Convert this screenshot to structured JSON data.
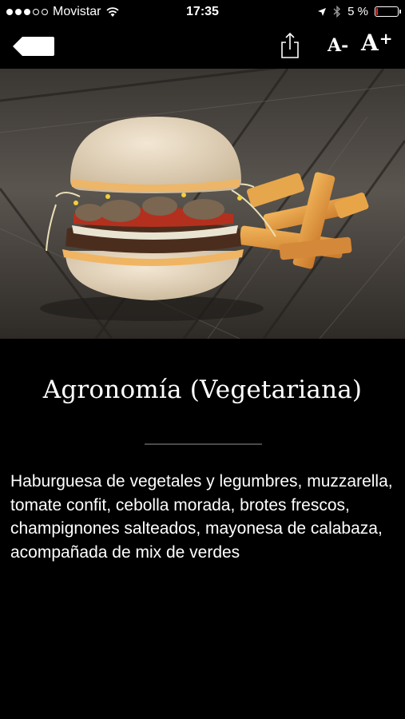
{
  "status_bar": {
    "carrier": "Movistar",
    "time": "17:35",
    "battery": "5 %",
    "battery_level": 0.05,
    "battery_color": "#e33333"
  },
  "nav": {
    "back_icon": "back-arrow-icon",
    "share_icon": "share-icon",
    "font_decrease_label": "A",
    "font_decrease_sign": "-",
    "font_increase_label": "A",
    "font_increase_sign": "+"
  },
  "dish": {
    "title": "Agronomía (Vegetariana)",
    "description": "Haburguesa de vegetales y legumbres, muzzarella, tomate confit, cebolla morada, brotes frescos, champignones salteados, mayonesa de calabaza, acompañada de mix de verdes"
  }
}
